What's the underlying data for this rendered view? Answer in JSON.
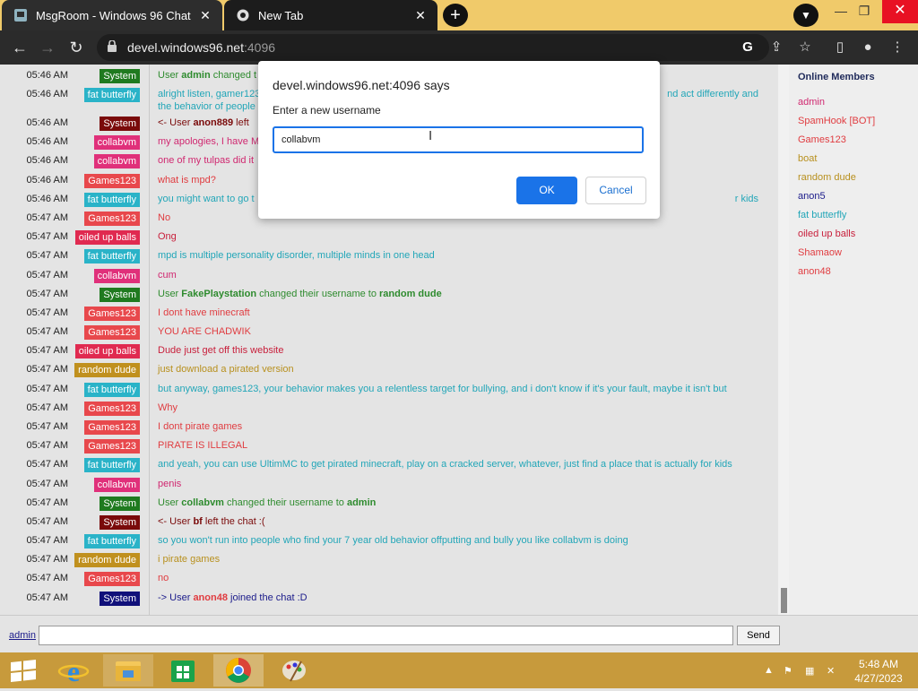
{
  "browser": {
    "tabs": [
      {
        "title": "MsgRoom - Windows 96 Chat"
      },
      {
        "title": "New Tab"
      }
    ],
    "url_host": "devel.windows96.net",
    "url_port": ":4096"
  },
  "dialog": {
    "title": "devel.windows96.net:4096 says",
    "prompt": "Enter a new username",
    "input_value": "collabvm",
    "ok_label": "OK",
    "cancel_label": "Cancel"
  },
  "chat": {
    "messages": [
      {
        "time": "05:46 AM",
        "user": "System",
        "bg": "#1f7a1f",
        "color": "#2e8b2e",
        "text": [
          {
            "t": "User "
          },
          {
            "t": "admin",
            "b": true
          },
          {
            "t": " changed t"
          }
        ]
      },
      {
        "time": "05:46 AM",
        "user": "fat butterfly",
        "bg": "#2ab3c8",
        "color": "#22a6b8",
        "text": [
          {
            "t": "alright listen, gamer123"
          }
        ],
        "text2": "the behavior of people",
        "text_right": "nd act differently and"
      },
      {
        "time": "05:46 AM",
        "user": "System",
        "bg": "#7a0a0a",
        "color": "#7a0a0a",
        "text": [
          {
            "t": "<- User "
          },
          {
            "t": "anon889",
            "b": true
          },
          {
            "t": " left"
          }
        ]
      },
      {
        "time": "05:46 AM",
        "user": "collabvm",
        "bg": "#e0307a",
        "color": "#d02870",
        "text": [
          {
            "t": "my apologies, I have MP"
          }
        ]
      },
      {
        "time": "05:46 AM",
        "user": "collabvm",
        "bg": "#e0307a",
        "color": "#d02870",
        "text": [
          {
            "t": "one of my tulpas did it"
          }
        ]
      },
      {
        "time": "05:46 AM",
        "user": "Games123",
        "bg": "#e8484c",
        "color": "#e03c40",
        "text": [
          {
            "t": "what is mpd?"
          }
        ]
      },
      {
        "time": "05:46 AM",
        "user": "fat butterfly",
        "bg": "#2ab3c8",
        "color": "#22a6b8",
        "text": [
          {
            "t": "you might want to go t"
          }
        ],
        "text_right": "r kids"
      },
      {
        "time": "05:47 AM",
        "user": "Games123",
        "bg": "#e8484c",
        "color": "#e03c40",
        "text": [
          {
            "t": "No"
          }
        ]
      },
      {
        "time": "05:47 AM",
        "user": "oiled up balls",
        "bg": "#e02a50",
        "color": "#c8203c",
        "text": [
          {
            "t": "Ong"
          }
        ]
      },
      {
        "time": "05:47 AM",
        "user": "fat butterfly",
        "bg": "#2ab3c8",
        "color": "#22a6b8",
        "text": [
          {
            "t": "mpd is multiple personality disorder, multiple minds in one head"
          }
        ]
      },
      {
        "time": "05:47 AM",
        "user": "collabvm",
        "bg": "#e0307a",
        "color": "#d02870",
        "text": [
          {
            "t": "cum"
          }
        ]
      },
      {
        "time": "05:47 AM",
        "user": "System",
        "bg": "#1f7a1f",
        "color": "#2e8b2e",
        "text": [
          {
            "t": "User "
          },
          {
            "t": "FakePlaystation",
            "b": true
          },
          {
            "t": " changed their username to "
          },
          {
            "t": "random dude",
            "b": true
          }
        ]
      },
      {
        "time": "05:47 AM",
        "user": "Games123",
        "bg": "#e8484c",
        "color": "#e03c40",
        "text": [
          {
            "t": "I dont have minecraft"
          }
        ]
      },
      {
        "time": "05:47 AM",
        "user": "Games123",
        "bg": "#e8484c",
        "color": "#e03c40",
        "text": [
          {
            "t": "YOU ARE CHADWIK"
          }
        ]
      },
      {
        "time": "05:47 AM",
        "user": "oiled up balls",
        "bg": "#e02a50",
        "color": "#c8203c",
        "text": [
          {
            "t": "Dude just get off this website"
          }
        ]
      },
      {
        "time": "05:47 AM",
        "user": "random dude",
        "bg": "#c0901e",
        "color": "#b8901e",
        "text": [
          {
            "t": "just download a pirated version"
          }
        ]
      },
      {
        "time": "05:47 AM",
        "user": "fat butterfly",
        "bg": "#2ab3c8",
        "color": "#22a6b8",
        "text": [
          {
            "t": "but anyway, games123, your behavior makes you a relentless target for bullying, and i don't know if it's your fault, maybe it isn't but"
          }
        ]
      },
      {
        "time": "05:47 AM",
        "user": "Games123",
        "bg": "#e8484c",
        "color": "#e03c40",
        "text": [
          {
            "t": "Why"
          }
        ]
      },
      {
        "time": "05:47 AM",
        "user": "Games123",
        "bg": "#e8484c",
        "color": "#e03c40",
        "text": [
          {
            "t": "I dont pirate games"
          }
        ]
      },
      {
        "time": "05:47 AM",
        "user": "Games123",
        "bg": "#e8484c",
        "color": "#e03c40",
        "text": [
          {
            "t": "PIRATE IS ILLEGAL"
          }
        ]
      },
      {
        "time": "05:47 AM",
        "user": "fat butterfly",
        "bg": "#2ab3c8",
        "color": "#22a6b8",
        "text": [
          {
            "t": "and yeah, you can use UltimMC to get pirated minecraft, play on a cracked server, whatever, just find a place that is actually for kids"
          }
        ]
      },
      {
        "time": "05:47 AM",
        "user": "collabvm",
        "bg": "#e0307a",
        "color": "#d02870",
        "text": [
          {
            "t": "penis"
          }
        ]
      },
      {
        "time": "05:47 AM",
        "user": "System",
        "bg": "#1f7a1f",
        "color": "#2e8b2e",
        "text": [
          {
            "t": "User "
          },
          {
            "t": "collabvm",
            "b": true
          },
          {
            "t": " changed their username to "
          },
          {
            "t": "admin",
            "b": true
          }
        ]
      },
      {
        "time": "05:47 AM",
        "user": "System",
        "bg": "#7a0a0a",
        "color": "#7a0a0a",
        "text": [
          {
            "t": "<- User "
          },
          {
            "t": "bf",
            "b": true
          },
          {
            "t": " left the chat :("
          }
        ]
      },
      {
        "time": "05:47 AM",
        "user": "fat butterfly",
        "bg": "#2ab3c8",
        "color": "#22a6b8",
        "text": [
          {
            "t": "so you won't run into people who find your 7 year old behavior offputting and bully you like collabvm is doing"
          }
        ]
      },
      {
        "time": "05:47 AM",
        "user": "random dude",
        "bg": "#c0901e",
        "color": "#b8901e",
        "text": [
          {
            "t": "i pirate games"
          }
        ]
      },
      {
        "time": "05:47 AM",
        "user": "Games123",
        "bg": "#e8484c",
        "color": "#e03c40",
        "text": [
          {
            "t": "no"
          }
        ]
      },
      {
        "time": "05:47 AM",
        "user": "System",
        "bg": "#10107a",
        "color": "#1a1a8a",
        "text": [
          {
            "t": "-> User "
          },
          {
            "t": "anon48",
            "b": true,
            "c": "#e03c40"
          },
          {
            "t": " joined the chat :D"
          }
        ]
      }
    ]
  },
  "members": {
    "title": "Online Members",
    "list": [
      {
        "name": "admin",
        "color": "#d02870"
      },
      {
        "name": "SpamHook [BOT]",
        "color": "#e03c40"
      },
      {
        "name": "Games123",
        "color": "#e03c40"
      },
      {
        "name": "boat",
        "color": "#b8901e"
      },
      {
        "name": "random dude",
        "color": "#b8901e"
      },
      {
        "name": "anon5",
        "color": "#1a1a8a"
      },
      {
        "name": "fat butterfly",
        "color": "#22a6b8"
      },
      {
        "name": "oiled up balls",
        "color": "#c8203c"
      },
      {
        "name": "Shamaow",
        "color": "#e03c40"
      },
      {
        "name": "anon48",
        "color": "#e03c40"
      }
    ]
  },
  "input_bar": {
    "my_name": "admin",
    "send_label": "Send"
  },
  "taskbar": {
    "time": "5:48 AM",
    "date": "4/27/2023"
  },
  "icons": [
    "msgroom-favicon",
    "chrome-favicon",
    "close-icon",
    "plus-icon",
    "tab-search-icon",
    "minimize-icon",
    "maximize-icon",
    "back-arrow-icon",
    "forward-arrow-icon",
    "reload-icon",
    "lock-icon",
    "google-icon",
    "share-icon",
    "star-icon",
    "sidepanel-icon",
    "profile-icon",
    "kebab-menu-icon",
    "windows-start-icon",
    "internet-explorer-icon",
    "file-explorer-icon",
    "store-icon",
    "chrome-icon",
    "paint-icon",
    "flag-icon",
    "network-icon",
    "volume-muted-icon"
  ]
}
